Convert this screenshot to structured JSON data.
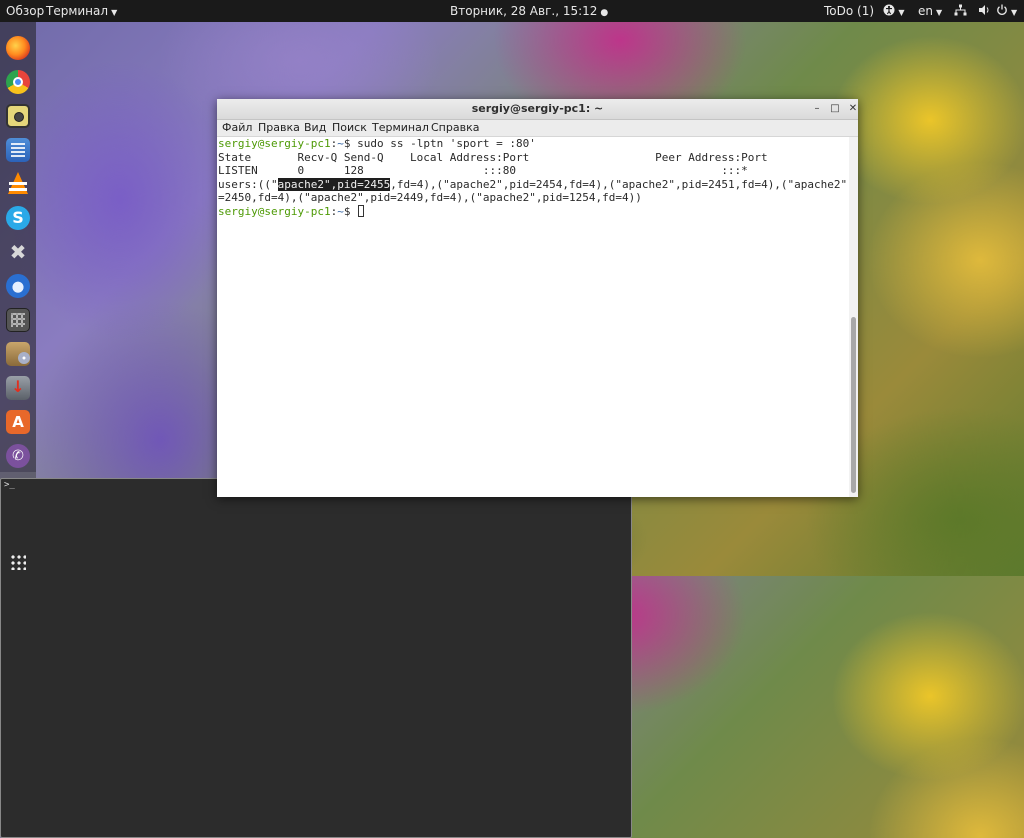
{
  "topbar": {
    "overview": "Обзор",
    "app_menu": "Терминал",
    "clock": "Вторник, 28 Авг., 15:12",
    "clock_dot": "●",
    "todo": "ToDo (1)",
    "accessibility_icon": "accessibility-icon",
    "language": "en",
    "network_icon": "network-icon",
    "volume_icon": "volume-icon",
    "power_icon": "power-icon"
  },
  "dock": {
    "items": [
      "firefox",
      "chrome",
      "speaker",
      "files",
      "vlc",
      "skype",
      "tools",
      "thunderbird",
      "calculator",
      "dvd",
      "installer",
      "software-store",
      "viber",
      "terminal"
    ],
    "skype_glyph": "S",
    "store_glyph": "A",
    "viber_glyph": "✆",
    "tools_glyph": "✖",
    "terminal_glyph": ">_"
  },
  "window": {
    "title": "sergiy@sergiy-pc1: ~",
    "minimize_glyph": "–",
    "maximize_glyph": "□",
    "close_glyph": "✕",
    "menu": [
      "Файл",
      "Правка",
      "Вид",
      "Поиск",
      "Терминал",
      "Справка"
    ]
  },
  "terminal": {
    "prompt_user": "sergiy@sergiy-pc1",
    "prompt_sep": ":",
    "prompt_path": "~",
    "prompt_end": "$ ",
    "command": "sudo ss -lptn 'sport = :80'",
    "header": "State       Recv-Q Send-Q    Local Address:Port                   Peer Address:Port",
    "row": "LISTEN      0      128                  :::80                               :::*",
    "users_prefix": "users:((\"",
    "users_selected": "apache2\",pid=2455",
    "users_rest1": ",fd=4),(\"apache2\",pid=2454,fd=4),(\"apache2\",pid=2451,fd=4),(\"apache2\",pid",
    "users_line2": "=2450,fd=4),(\"apache2\",pid=2449,fd=4),(\"apache2\",pid=1254,fd=4))"
  }
}
